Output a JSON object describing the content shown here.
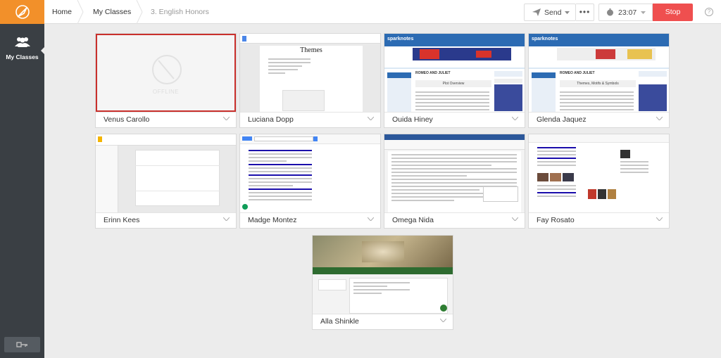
{
  "breadcrumbs": [
    "Home",
    "My Classes",
    "3. English Honors"
  ],
  "sidebar": {
    "nav_label": "My Classes"
  },
  "toolbar": {
    "send_label": "Send",
    "more_label": "•••",
    "timer": "23:07",
    "stop_label": "Stop"
  },
  "colors": {
    "accent": "#f2902a",
    "stop": "#ef4f4f",
    "sidebar": "#3a3f44",
    "selected_border": "#c9302c"
  },
  "students": [
    {
      "name": "Venus Carollo",
      "status": "OFFLINE",
      "screen": "offline"
    },
    {
      "name": "Luciana Dopp",
      "screen": "doc",
      "doc_title": "Themes"
    },
    {
      "name": "Ouida Hiney",
      "screen": "sparknotes",
      "site": "sparknotes",
      "page_title": "ROMEO AND JULIET",
      "subtitle": "Plot Overview"
    },
    {
      "name": "Glenda Jaquez",
      "screen": "sparknotes",
      "site": "sparknotes",
      "page_title": "ROMEO AND JULIET",
      "subtitle": "Themes, Motifs & Symbols"
    },
    {
      "name": "Erinn Kees",
      "screen": "slides"
    },
    {
      "name": "Madge Montez",
      "screen": "search"
    },
    {
      "name": "Omega Nida",
      "screen": "word"
    },
    {
      "name": "Fay Rosato",
      "screen": "search2"
    },
    {
      "name": "Alla Shinkle",
      "screen": "classroom"
    }
  ]
}
